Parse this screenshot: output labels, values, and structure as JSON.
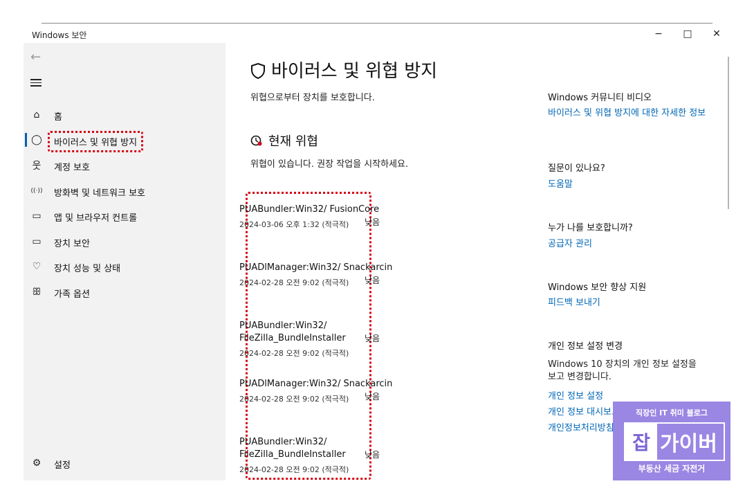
{
  "window": {
    "title": "Windows 보안",
    "minimize": "−",
    "maximize": "□",
    "close": "✕"
  },
  "sidebar": {
    "back_icon": "←",
    "items": [
      {
        "icon": "⌂",
        "label": "홈"
      },
      {
        "icon": "◯",
        "label": "바이러스 및 위협 방지"
      },
      {
        "icon": "웃",
        "label": "계정 보호"
      },
      {
        "icon": "((·))",
        "label": "방화벽 및 네트워크 보호"
      },
      {
        "icon": "▭",
        "label": "앱 및 브라우저 컨트롤"
      },
      {
        "icon": "▭",
        "label": "장치 보안"
      },
      {
        "icon": "♡",
        "label": "장치 성능 및 상태"
      },
      {
        "icon": "ꕥ",
        "label": "가족 옵션"
      }
    ],
    "settings": {
      "icon": "⚙",
      "label": "설정"
    }
  },
  "main": {
    "title": "바이러스 및 위협 방지",
    "subtitle": "위협으로부터 장치를 보호합니다.",
    "current_threats": {
      "title": "현재 위협",
      "subtitle": "위협이 있습니다. 권장 작업을 시작하세요.",
      "items": [
        {
          "name": "PUABundler:Win32/ FusionCore",
          "date": "2024-03-06 오후 1:32 (적극적)",
          "severity": "낮음"
        },
        {
          "name": "PUADlManager:Win32/ Snackarcin",
          "date": "2024-02-28 오전 9:02 (적극적)",
          "severity": "낮음"
        },
        {
          "name": "PUABundler:Win32/ FileZilla_BundleInstaller",
          "date": "2024-02-28 오전 9:02 (적극적)",
          "severity": "낮음"
        },
        {
          "name": "PUADlManager:Win32/ Snackarcin",
          "date": "2024-02-28 오전 9:02 (적극적)",
          "severity": "낮음"
        },
        {
          "name": "PUABundler:Win32/ FileZilla_BundleInstaller",
          "date": "2024-02-28 오전 9:02 (적극적)",
          "severity": "낮음"
        }
      ]
    }
  },
  "right_panel": {
    "community_video": {
      "heading": "Windows 커뮤니티 비디오",
      "link": "바이러스 및 위협 방지에 대한 자세한 정보"
    },
    "question": {
      "heading": "질문이 있나요?",
      "link": "도움말"
    },
    "who_protects": {
      "heading": "누가 나를 보호합니까?",
      "link": "공급자 관리"
    },
    "improve": {
      "heading": "Windows 보안 향상 지원",
      "link": "피드백 보내기"
    },
    "privacy": {
      "heading": "개인 정보 설정 변경",
      "text": "Windows 10 장치의 개인 정보 설정을 보고 변경합니다.",
      "links": [
        "개인 정보 설정",
        "개인 정보 대시보드",
        "개인정보처리방침"
      ]
    }
  },
  "watermark": {
    "top": "직장인 IT 취미 블로그",
    "mark": "잡",
    "brand": "가이버",
    "bottom": "부동산 세금 자전거"
  }
}
